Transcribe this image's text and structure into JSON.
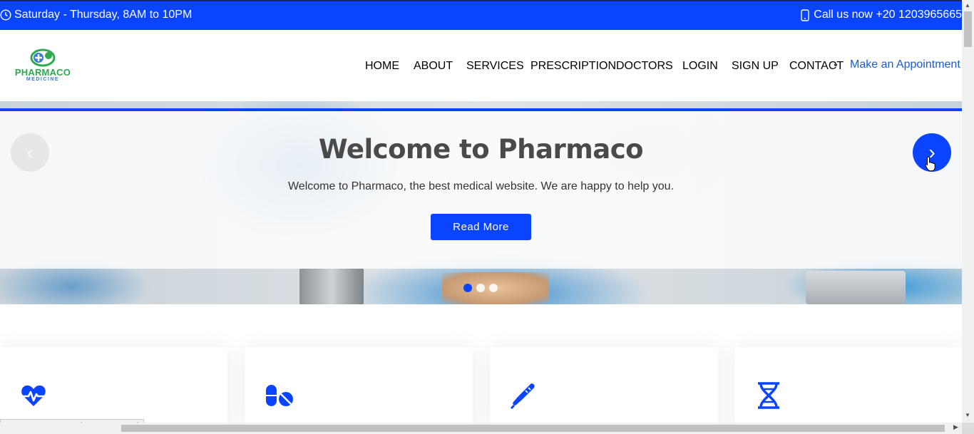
{
  "topbar": {
    "hours_text": "Saturday - Thursday, 8AM to 10PM",
    "phone_text": "Call us now +20 1203965665"
  },
  "logo": {
    "brand": "PHARMACO",
    "sub": "MEDICINE"
  },
  "nav": {
    "items": [
      {
        "label": "HOME",
        "active": true
      },
      {
        "label": "ABOUT"
      },
      {
        "label": "SERVICES"
      },
      {
        "label": "PRESCRIPTION"
      },
      {
        "label": "DOCTORS"
      },
      {
        "label": "LOGIN"
      },
      {
        "label": "SIGN UP"
      },
      {
        "label": "CONTACT"
      }
    ],
    "appointment_label": "Make an Appointment"
  },
  "hero": {
    "title": "Welcome to Pharmaco",
    "text": "Welcome to Pharmaco, the best medical website. We are happy to help you.",
    "button_label": "Read More",
    "prev_glyph": "‹",
    "next_glyph": "›",
    "slide_count": 3,
    "active_slide": 1
  },
  "features": {
    "icons": [
      "heartbeat-icon",
      "pills-icon",
      "thermometer-icon",
      "dna-icon"
    ]
  },
  "status_bar": {
    "url": "127.0.0.1:8000/#hero-carousel"
  },
  "colors": {
    "primary": "#0b44ff",
    "nav_active": "#1aa3c9",
    "text_dark": "#2c3e50"
  }
}
